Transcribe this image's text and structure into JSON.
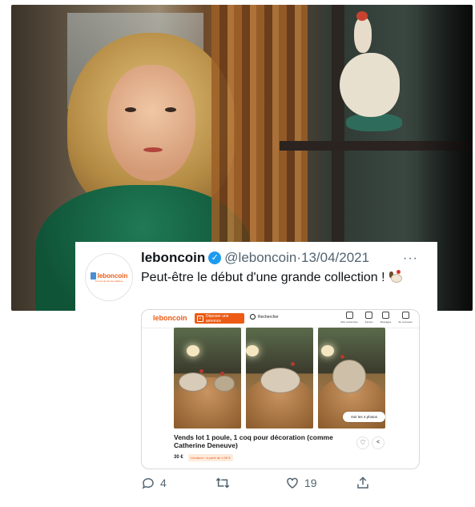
{
  "tweet": {
    "display_name": "leboncoin",
    "handle": "@leboncoin",
    "separator": "·",
    "date": "13/04/2021",
    "more": "···",
    "text": "Peut-être le début d'une grande collection !",
    "avatar_logo": "leboncoin",
    "avatar_sub": "Trouvé de bonnes affaires",
    "replies": "4",
    "likes": "19"
  },
  "embed": {
    "nav": {
      "logo": "leboncoin",
      "deposit": "Déposer une annonce",
      "search": "Rechercher",
      "actions": [
        "Mes recherches",
        "Favoris",
        "Messages",
        "Se connecter"
      ]
    },
    "see_photos": "Voir les 4 photos",
    "ad_title": "Vends lot 1 poule, 1 coq pour décoration (comme Catherine Deneuve)",
    "ad_price": "30 €",
    "ad_delivery": "Livraison : à partir de 4,99 €"
  },
  "icons": [
    "verified-badge-icon",
    "more-icon",
    "reply-icon",
    "retweet-icon",
    "like-icon",
    "share-icon",
    "heart-icon",
    "share-arrow-icon",
    "search-icon",
    "rooster-emoji"
  ],
  "colors": {
    "lbc_orange": "#ec5a13",
    "twitter_blue": "#1d9bf0",
    "meta_gray": "#536471"
  }
}
